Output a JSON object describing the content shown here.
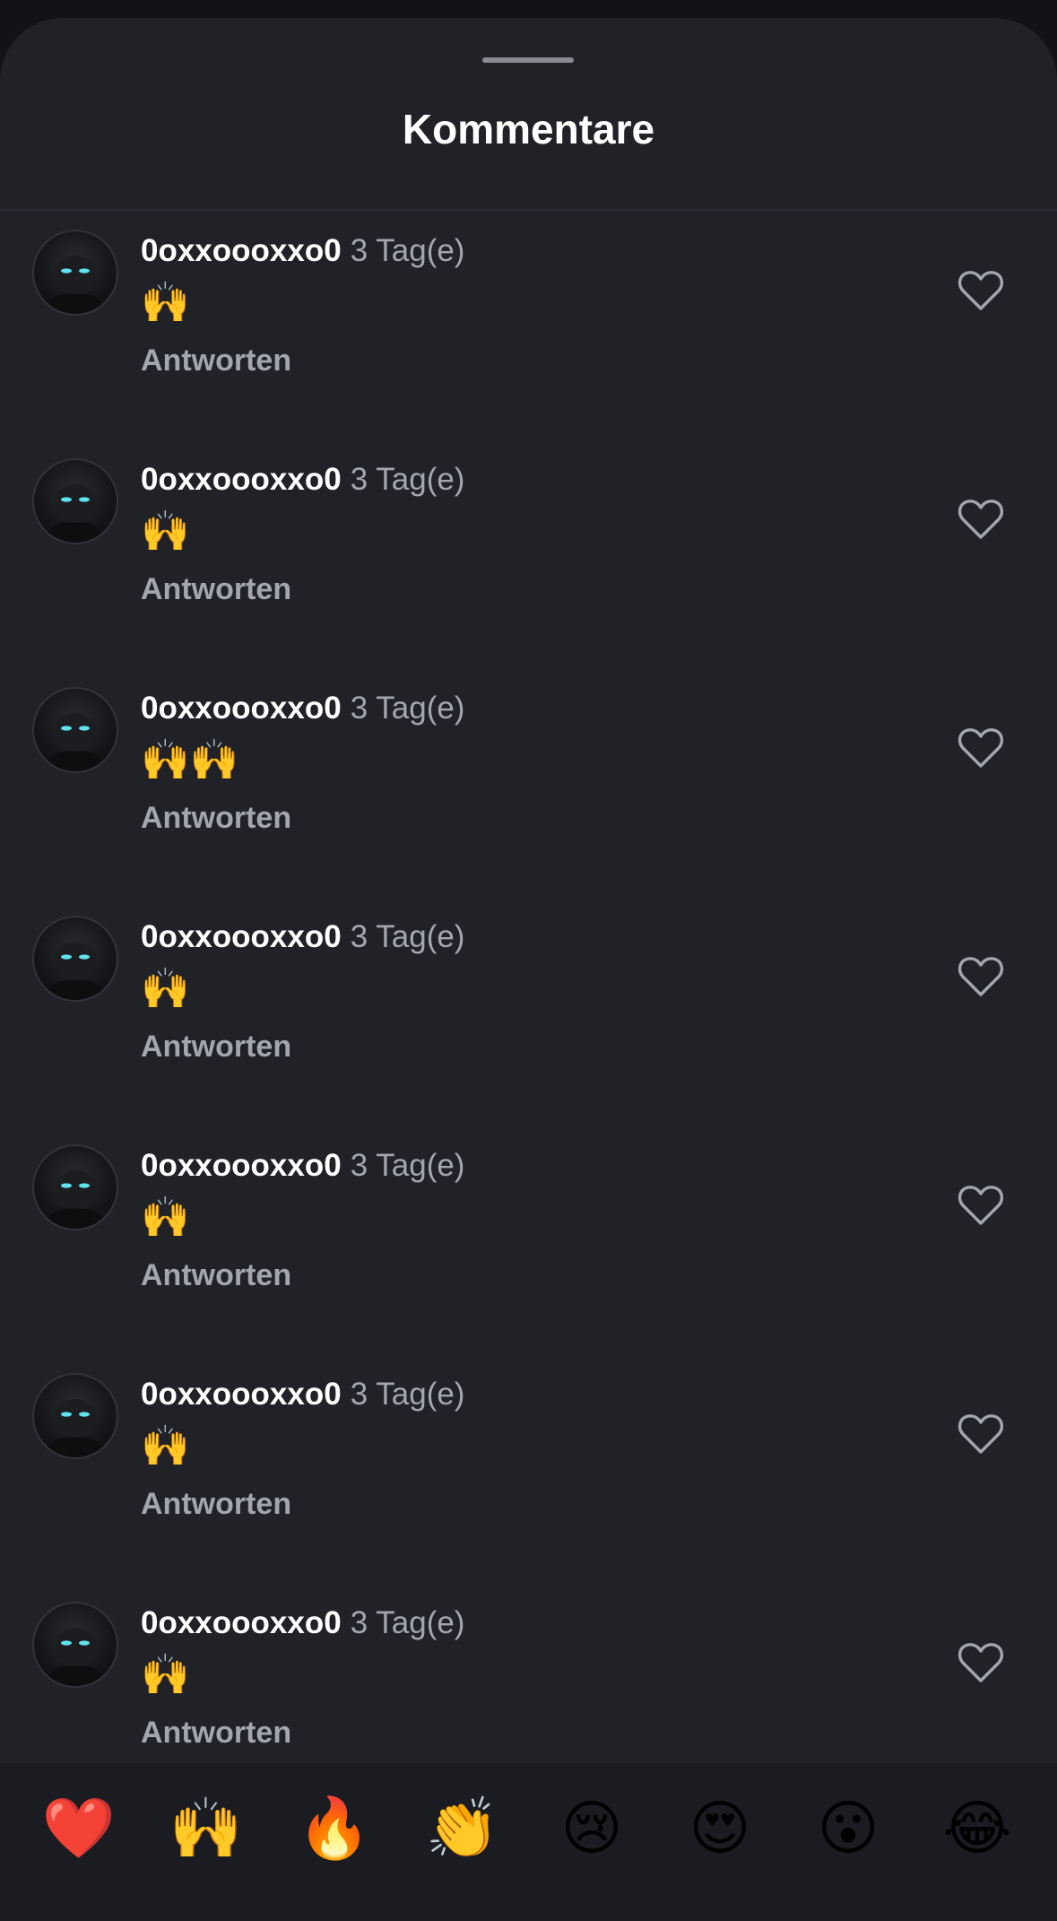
{
  "sheet": {
    "title": "Kommentare"
  },
  "comments": [
    {
      "username": "0oxxoooxxo0",
      "time": "3 Tag(e)",
      "text": "🙌",
      "reply_label": "Antworten"
    },
    {
      "username": "0oxxoooxxo0",
      "time": "3 Tag(e)",
      "text": "🙌",
      "reply_label": "Antworten"
    },
    {
      "username": "0oxxoooxxo0",
      "time": "3 Tag(e)",
      "text": "🙌🙌",
      "reply_label": "Antworten"
    },
    {
      "username": "0oxxoooxxo0",
      "time": "3 Tag(e)",
      "text": "🙌",
      "reply_label": "Antworten"
    },
    {
      "username": "0oxxoooxxo0",
      "time": "3 Tag(e)",
      "text": "🙌",
      "reply_label": "Antworten"
    },
    {
      "username": "0oxxoooxxo0",
      "time": "3 Tag(e)",
      "text": "🙌",
      "reply_label": "Antworten"
    },
    {
      "username": "0oxxoooxxo0",
      "time": "3 Tag(e)",
      "text": "🙌",
      "reply_label": "Antworten"
    }
  ],
  "reactions": [
    "❤️",
    "🙌",
    "🔥",
    "👏",
    "😢",
    "😍",
    "😮",
    "😂"
  ],
  "colors": {
    "sheet_background": "#212228",
    "secondary_text": "#a4a6ae",
    "avatar_eyes": "#5fe3ee"
  },
  "icons": {
    "like": "heart-outline-icon",
    "grabber": "drag-handle"
  }
}
